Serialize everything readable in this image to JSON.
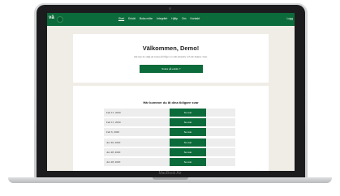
{
  "device": {
    "brand_label": "MacBook Air"
  },
  "navbar": {
    "logo_text": "vä",
    "links": [
      "Start",
      "Enkät",
      "Boka möte",
      "Integritet",
      "Hjälp",
      "Om",
      "Kontakt"
    ],
    "active_link": "Start",
    "logout_label": "Logg"
  },
  "welcome": {
    "title": "Välkommen, Demo!",
    "subtitle": "Här kan du välja att svara på frågor om ditt arbetsliv och din balans i livet.",
    "button_label": "Svara på enkät  ↗"
  },
  "history": {
    "title": "Här kommer du åt dina tidigare svar",
    "rows": [
      {
        "date": "Feb 17, 2020",
        "button": "Se svar"
      },
      {
        "date": "Feb 17, 2020",
        "button": "Se svar"
      },
      {
        "date": "Feb 6, 2020",
        "button": "Se svar"
      },
      {
        "date": "Jun 30, 2020",
        "button": "Se svar"
      },
      {
        "date": "Jun 28, 2020",
        "button": "Se svar"
      },
      {
        "date": "Jun 28, 2020",
        "button": "Se svar"
      }
    ]
  },
  "colors": {
    "brand_green": "#0c6b3a",
    "page_bg": "#f0ede6"
  }
}
